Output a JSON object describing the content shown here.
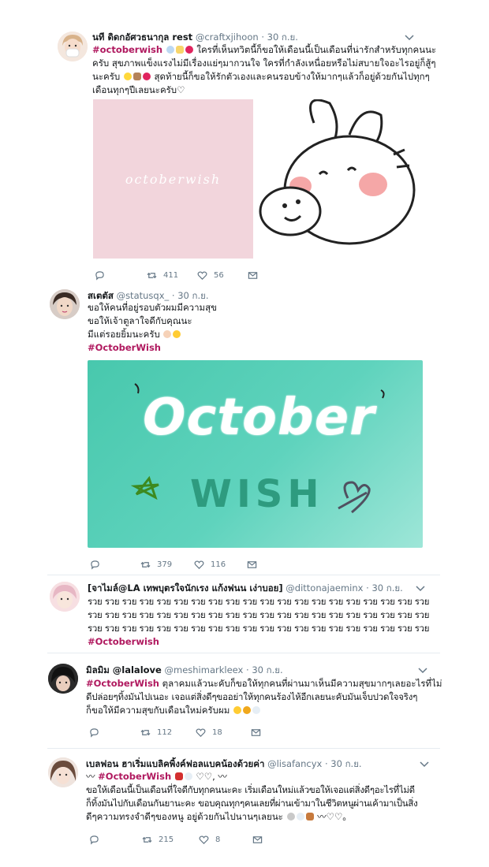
{
  "colors": {
    "hashtag": "#b0195f",
    "muted": "#657786",
    "text": "#14171a",
    "divider": "#e6ecf0",
    "pink_panel": "#f2d5dc",
    "teal_panel": "#56cdb6"
  },
  "tweets": [
    {
      "name": "นที ดิดกอัศวธนากุล rest",
      "handle": "@craftxjihoon",
      "dot": "·",
      "date": "30 ก.ย.",
      "hashtag": "#octoberwish",
      "lines": [
        "ใครที่เห็นทวิตนี้ก็ขอให้เดือนนี้เป็นเดือนที่น่ารักสำหรับทุกคนนะ",
        "ครับ สุขภาพแข็งแรงไม่มีเรื่องแย่ๆมากวนใจ ใครที่กำลังเหนื่อยหรือไม่สบายใจอะไรอยู่ก็สู้ๆ",
        "นะครับ",
        "สุดท้ายนี้ก็ขอให้รักตัวเองและคนรอบข้างให้มากๆแล้วก็อยู่ด้วยกันไปทุกๆ",
        "เดือนทุกๆปีเลยนะครับ♡"
      ],
      "media_text": "octoberwish",
      "replies": "",
      "retweets": "411",
      "likes": "56"
    },
    {
      "name": "สเตตัส",
      "handle": "@statusqx_",
      "dot": "·",
      "date": "30 ก.ย.",
      "lines": [
        "ขอให้คนที่อยู่รอบตัวผมมีความสุข",
        "ขอให้เจ้าตูลาใจดีกับคุณนะ",
        "มีแต่รอยยิ้มนะครับ"
      ],
      "hashtag": "#OctoberWish",
      "media_title": "October",
      "media_sub": "WISH",
      "replies": "",
      "retweets": "379",
      "likes": "116"
    },
    {
      "name": "[จาไมล์@LA เทพบุตรใจนักเรง แก้งฟนน เง่าบอย]",
      "handle": "@dittonajaeminx",
      "dot": "·",
      "date": "30 ก.ย.",
      "lines": [
        "รวย รวย รวย รวย รวย รวย รวย รวย รวย รวย รวย รวย รวย รวย รวย รวย รวย รวย รวย รวย",
        "รวย รวย รวย รวย รวย รวย รวย รวย รวย รวย รวย รวย รวย รวย รวย รวย รวย รวย รวย รวย",
        "รวย รวย รวย รวย รวย รวย รวย รวย รวย รวย รวย รวย รวย รวย รวย รวย รวย รวย รวย รวย"
      ],
      "hashtag": "#Octoberwish"
    },
    {
      "name": "มิลมิม @lalalove",
      "handle": "@meshimarkleex",
      "dot": "·",
      "date": "30 ก.ย.",
      "hashtag": "#OctoberWish",
      "lines": [
        "ตุลาคมแล้วนะคับก็ขอให้ทุกคนที่ผ่านมาเห็นมีความสุขมากๆเลยอะไรที่ไม่",
        "ดีปล่อยๆทิ้งมันไปเนอะ เจอแต่สิ่งดีๆขออย่าให้ทุกคนร้องไห้อีกเลยนะคับมันเจ็บปวดใจจริงๆ",
        "ก็ขอให้มีความสุขกับเดือนใหม่ครับผม"
      ],
      "replies": "",
      "retweets": "112",
      "likes": "18"
    },
    {
      "name": "เบลฟอน ฮาเริ่มแบลิคพิ้งค์ฟอลแบคน้องด้วยค่า",
      "handle": "@lisafancyx",
      "dot": "·",
      "date": "30 ก.ย.",
      "prefix": "〰",
      "hashtag": "#OctoberWish",
      "suffix": "♡♡, 〰",
      "lines": [
        "ขอให้เดือนนี้เป็นเดือนที่ใจดีกับทุกคนนะคะ เริ่มเดือนใหม่แล้วขอให้เจอแต่สิ่งดีๆอะไรที่ไม่ดี",
        "ก็ทิ้งมันไปกับเดือนกันยานะคะ ขอบคุณทุกๆคนเลยที่ผ่านเข้ามาในชีวิตหนูผ่านเค้ามาเป็นสิ่ง",
        "ดีๆความทรงจำดีๆของหนู อยู่ด้วยกันไปนานๆเลยนะ"
      ],
      "line_end": "〰♡♡。",
      "replies": "",
      "retweets": "215",
      "likes": "8"
    }
  ]
}
